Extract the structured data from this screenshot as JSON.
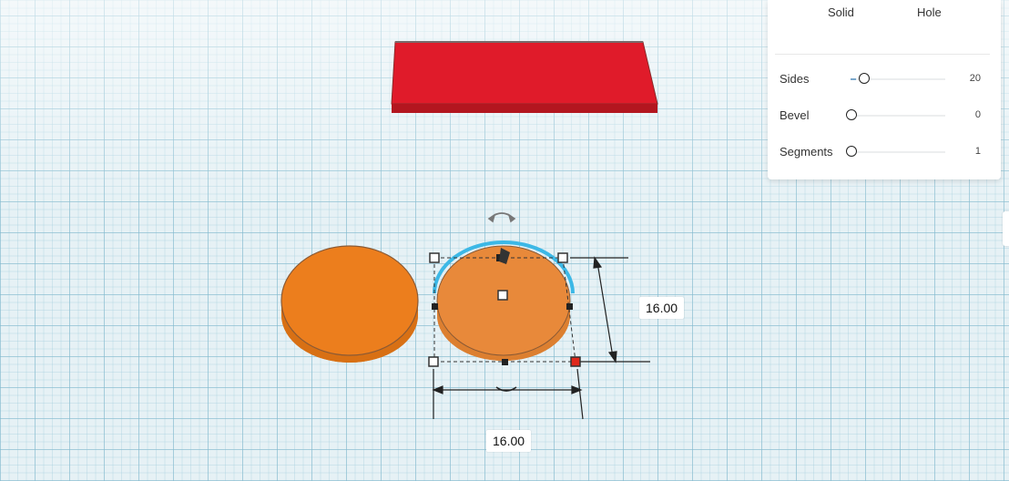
{
  "workplane": {
    "dimensions": {
      "height": "16.00",
      "width": "16.00"
    }
  },
  "colors": {
    "box_red": "#e01b2a",
    "cylinder_orange": "#ec7e1d",
    "selected_orange": "#e8893a",
    "selection_outline": "#3cb8e6",
    "handle_red": "#e0281b"
  },
  "inspector": {
    "type_solid": "Solid",
    "type_hole": "Hole",
    "properties": [
      {
        "label": "Sides",
        "value": "20"
      },
      {
        "label": "Bevel",
        "value": "0"
      },
      {
        "label": "Segments",
        "value": "1"
      }
    ]
  }
}
